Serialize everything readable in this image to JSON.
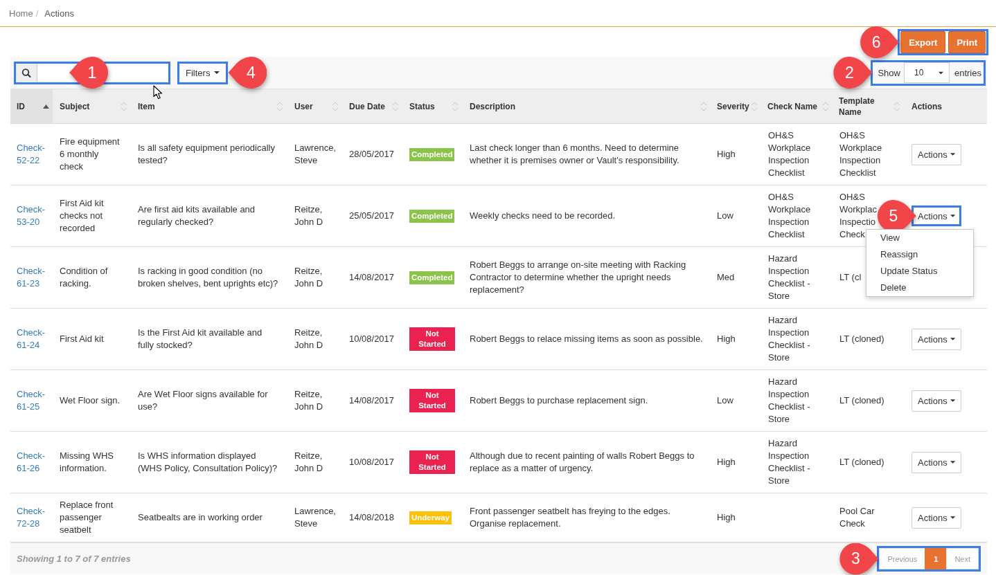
{
  "breadcrumb": {
    "items": [
      "Home",
      "Actions"
    ],
    "separator": "/"
  },
  "export_bar": {
    "callout": "6",
    "buttons": [
      "Export",
      "Print"
    ]
  },
  "toolbar": {
    "search": {
      "callout": "1"
    },
    "filters": {
      "label": "Filters",
      "callout": "4"
    },
    "page_size": {
      "label": "Show",
      "value": "10",
      "suffix": "entries",
      "callout": "2"
    }
  },
  "table": {
    "columns": [
      {
        "label": "ID",
        "sortable": true,
        "sorted": true
      },
      {
        "label": "Subject",
        "sortable": true,
        "sorted": false
      },
      {
        "label": "Item",
        "sortable": true,
        "sorted": false
      },
      {
        "label": "User",
        "sortable": true,
        "sorted": false
      },
      {
        "label": "Due Date",
        "sortable": true,
        "sorted": false
      },
      {
        "label": "Status",
        "sortable": true,
        "sorted": false
      },
      {
        "label": "Description",
        "sortable": true,
        "sorted": false
      },
      {
        "label": "Severity",
        "sortable": true,
        "sorted": false
      },
      {
        "label": "Check Name",
        "sortable": true,
        "sorted": false
      },
      {
        "label": "Template Name",
        "sortable": true,
        "sorted": false
      },
      {
        "label": "Actions",
        "sortable": false,
        "sorted": false
      }
    ],
    "rows": [
      {
        "id": "Check-52-22",
        "subject": "Fire equipment 6 monthly check",
        "item": "Is all safety equipment periodically tested?",
        "user": "Lawrence, Steve",
        "due_date": "28/05/2017",
        "status": {
          "text": "Completed",
          "color": "#8cc34b"
        },
        "description": "Last check longer than 6 months. Need to determine whether it is premises owner or Vault's responsibility.",
        "severity": "High",
        "check_name": "OH&S Workplace Inspection Checklist",
        "template_name": "OH&S Workplace Inspection Checklist",
        "actions": {
          "label": "Actions"
        }
      },
      {
        "id": "Check-53-20",
        "subject": "First Aid kit checks not recorded",
        "item": "Are first aid kits available and regularly checked?",
        "user": "Reitze, John D",
        "due_date": "25/05/2017",
        "status": {
          "text": "Completed",
          "color": "#8cc34b"
        },
        "description": "Weekly checks need to be recorded.",
        "severity": "Low",
        "check_name": "OH&S Workplace Inspection Checklist",
        "template_name": "OH&S Workplac Inspectio Check",
        "actions": {
          "label": "Actions",
          "callout": "5",
          "menu": [
            "View",
            "Reassign",
            "Update Status",
            "Delete"
          ]
        }
      },
      {
        "id": "Check-61-23",
        "subject": "Condition of racking.",
        "item": "Is racking in good condition (no broken shelves, bent uprights etc)?",
        "user": "Reitze, John D",
        "due_date": "14/08/2017",
        "status": {
          "text": "Completed",
          "color": "#8cc34b"
        },
        "description": "Robert Beggs to arrange on-site meeting with Racking Contractor to determine whether the upright needs replacement?",
        "severity": "Med",
        "check_name": "Hazard Inspection Checklist - Store",
        "template_name": "LT (cl"
      },
      {
        "id": "Check-61-24",
        "subject": "First Aid kit",
        "item": "Is the First Aid kit available and fully stocked?",
        "user": "Reitze, John D",
        "due_date": "10/08/2017",
        "status": {
          "text": "Not Started",
          "color": "#e9224f"
        },
        "description": "Robert Beggs to relace missing items as soon as possible.",
        "severity": "High",
        "check_name": "Hazard Inspection Checklist - Store",
        "template_name": "LT (cloned)",
        "actions": {
          "label": "Actions"
        }
      },
      {
        "id": "Check-61-25",
        "subject": "Wet Floor sign.",
        "item": "Are Wet Floor signs available for use?",
        "user": "Reitze, John D",
        "due_date": "14/08/2017",
        "status": {
          "text": "Not Started",
          "color": "#e9224f"
        },
        "description": "Robert Beggs to purchase replacement sign.",
        "severity": "Low",
        "check_name": "Hazard Inspection Checklist - Store",
        "template_name": "LT (cloned)",
        "actions": {
          "label": "Actions"
        }
      },
      {
        "id": "Check-61-26",
        "subject": "Missing WHS information.",
        "item": "Is WHS information displayed (WHS Policy, Consultation Policy)?",
        "user": "Reitze, John D",
        "due_date": "10/08/2017",
        "status": {
          "text": "Not Started",
          "color": "#e9224f"
        },
        "description": "Although due to recent painting of walls Robert Beggs to replace as a matter of urgency.",
        "severity": "High",
        "check_name": "Hazard Inspection Checklist - Store",
        "template_name": "LT (cloned)",
        "actions": {
          "label": "Actions"
        }
      },
      {
        "id": "Check-72-28",
        "subject": "Replace front passenger seatbelt",
        "item": "Seatbealts are in working order",
        "user": "Lawrence, Steve",
        "due_date": "14/08/2018",
        "status": {
          "text": "Underway",
          "color": "#fcbf0a"
        },
        "description": "Front passenger seatbelt has freying to the edges. Organise replacement.",
        "severity": "High",
        "template_name": "Pool Car Check",
        "actions": {
          "label": "Actions"
        }
      }
    ]
  },
  "footer": {
    "info": "Showing 1 to 7 of 7 entries",
    "pagination": {
      "callout": "3",
      "pages": [
        {
          "label": "Previous",
          "selected": false,
          "disabled": true
        },
        {
          "label": "1",
          "selected": true,
          "disabled": false
        },
        {
          "label": "Next",
          "selected": false,
          "disabled": true
        }
      ]
    }
  }
}
